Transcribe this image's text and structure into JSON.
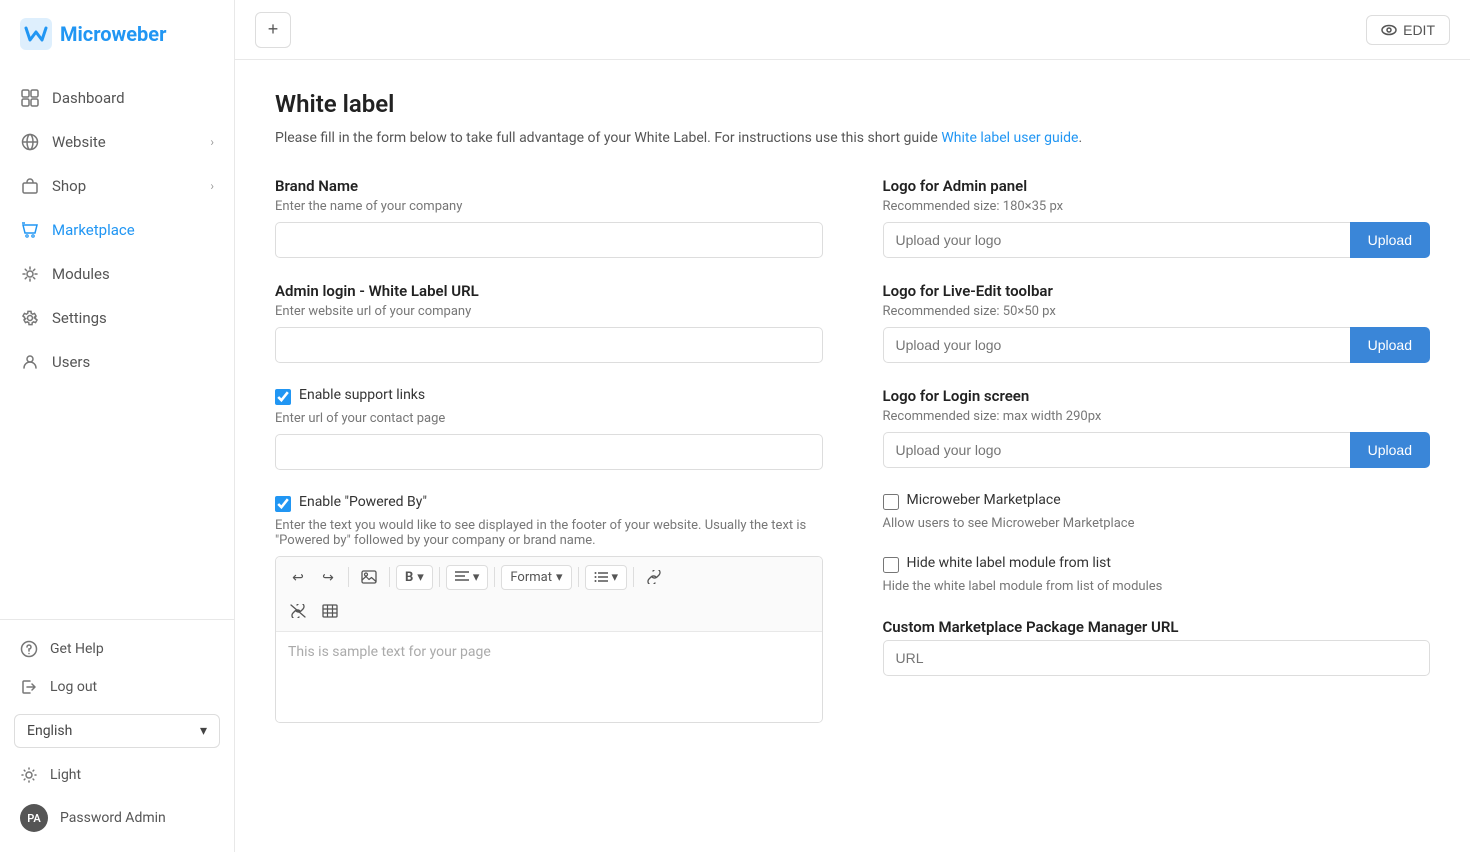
{
  "sidebar": {
    "logo_text": "Microweber",
    "nav_items": [
      {
        "id": "dashboard",
        "label": "Dashboard",
        "icon": "grid"
      },
      {
        "id": "website",
        "label": "Website",
        "icon": "globe",
        "has_chevron": true
      },
      {
        "id": "shop",
        "label": "Shop",
        "icon": "bag",
        "has_chevron": true
      },
      {
        "id": "marketplace",
        "label": "Marketplace",
        "icon": "puzzle",
        "active": true
      },
      {
        "id": "modules",
        "label": "Modules",
        "icon": "settings-grid"
      },
      {
        "id": "settings",
        "label": "Settings",
        "icon": "gear"
      },
      {
        "id": "users",
        "label": "Users",
        "icon": "person"
      }
    ],
    "bottom": {
      "help_label": "Get Help",
      "logout_label": "Log out",
      "theme_label": "Light",
      "language": "English",
      "user_initials": "PA",
      "user_name": "Password Admin"
    }
  },
  "topbar": {
    "add_btn_label": "+",
    "edit_btn_label": "EDIT"
  },
  "page": {
    "title": "White label",
    "description": "Please fill in the form below to take full advantage of your White Label. For instructions use this short guide",
    "guide_link": "White label user guide",
    "guide_link_suffix": "."
  },
  "form": {
    "brand_name": {
      "label": "Brand Name",
      "sublabel": "Enter the name of your company",
      "placeholder": ""
    },
    "admin_url": {
      "label": "Admin login - White Label URL",
      "sublabel": "Enter website url of your company",
      "placeholder": ""
    },
    "support_links": {
      "label": "Enable support links",
      "sublabel": "Enter url of your contact page",
      "checked": true,
      "placeholder": ""
    },
    "powered_by": {
      "label": "Enable \"Powered By\"",
      "sublabel": "Enter the text you would like to see displayed in the footer of your website. Usually the text is \"Powered by\" followed by your company or brand name.",
      "checked": true
    },
    "editor_placeholder": "This is sample text for your page",
    "logo_admin": {
      "label": "Logo for Admin panel",
      "sublabel": "Recommended size: 180×35 px",
      "placeholder": "Upload your logo",
      "upload_btn": "Upload"
    },
    "logo_liveedit": {
      "label": "Logo for Live-Edit toolbar",
      "sublabel": "Recommended size: 50×50 px",
      "placeholder": "Upload your logo",
      "upload_btn": "Upload"
    },
    "logo_login": {
      "label": "Logo for Login screen",
      "sublabel": "Recommended size: max width 290px",
      "placeholder": "Upload your logo",
      "upload_btn": "Upload"
    },
    "marketplace_checkbox": {
      "label": "Microweber Marketplace",
      "sublabel": "Allow users to see Microweber Marketplace",
      "checked": false
    },
    "hide_module_checkbox": {
      "label": "Hide white label module from list",
      "sublabel": "Hide the white label module from list of modules",
      "checked": false
    },
    "custom_url": {
      "label": "Custom Marketplace Package Manager URL",
      "placeholder": "URL"
    }
  },
  "toolbar": {
    "format_label": "Format",
    "bold_label": "B"
  }
}
